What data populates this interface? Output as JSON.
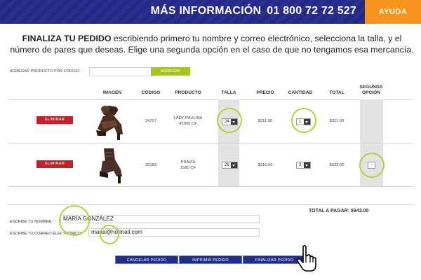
{
  "header": {
    "info_label": "MÁS INFORMACIÓN",
    "phone": "01 800 72 72 527",
    "help_label": "AYUDA"
  },
  "intro": {
    "bold": "FINALIZA TU PEDIDO",
    "text": " escribiendo primero tu nombre y correo electrónico, selecciona la talla, y el número de pares que deseas. Elige una segunda opción en el caso de que no tengamos esa mercancía."
  },
  "add_product": {
    "label": "AGREGAR PRODUCTO POR CÓDIGO:",
    "value": "",
    "button": "AGREGAR"
  },
  "table": {
    "headers": {
      "imagen": "IMAGEN",
      "codigo": "CÓDIGO",
      "producto": "PRODUCTO",
      "talla": "TALLA",
      "precio": "PRECIO",
      "cantidad": "CANTIDAD",
      "total": "TOTAL",
      "segunda_1": "SEGUNDA",
      "segunda_2": "OPCIÓN"
    },
    "rows": [
      {
        "remove": "ELIMINAR",
        "code": "24757",
        "product_line1": "LADY PAULINA",
        "product_line2": "45905 CF",
        "size": "24",
        "price": "$311.00",
        "qty": "1",
        "total": "$311.00",
        "second": ""
      },
      {
        "remove": "ELIMINAR",
        "code": "25183",
        "product_line1": "PRAVIA",
        "product_line2": "1580 CF",
        "size": "26",
        "price": "$316.00",
        "qty": "2",
        "total": "$632.00",
        "second": "-"
      }
    ]
  },
  "total_to_pay": "TOTAL A PAGAR: $943.00",
  "form": {
    "name_label": "ESCRIBE TU NOMBRE:",
    "name_value": "MARÍA GONZÁLEZ",
    "email_label": "ESCRIBE TU CORREO ELECTRÓNICO:",
    "email_value": "maria@hotmail.com"
  },
  "buttons": {
    "cancel": "CANCELAR PEDIDO",
    "print": "IMPRIMIR PEDIDO",
    "finish": "FINALIZAR PEDIDO"
  },
  "colors": {
    "header_blue": "#2a2f8f",
    "help_orange": "#f7941d",
    "remove_red": "#c8202a",
    "accent_green": "#b5d334",
    "button_navy": "#1f2d8c"
  }
}
